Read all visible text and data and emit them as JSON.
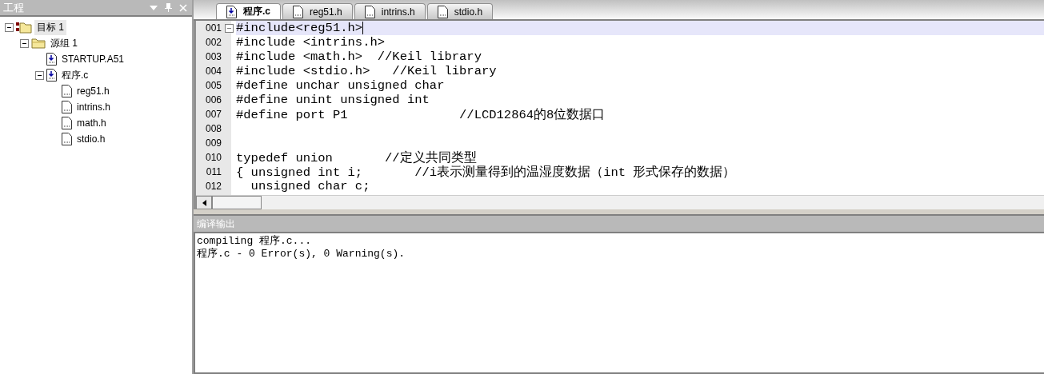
{
  "project_panel": {
    "title": "工程",
    "tree": [
      {
        "label": "目标 1",
        "kind": "target",
        "selected": true,
        "expanded": true,
        "children": [
          {
            "label": "源组 1",
            "kind": "folder",
            "selected": false,
            "expanded": true,
            "children": [
              {
                "label": "STARTUP.A51",
                "kind": "source",
                "selected": false
              },
              {
                "label": "程序.c",
                "kind": "source",
                "selected": false,
                "expanded": true,
                "children": [
                  {
                    "label": "reg51.h",
                    "kind": "header",
                    "selected": false
                  },
                  {
                    "label": "intrins.h",
                    "kind": "header",
                    "selected": false
                  },
                  {
                    "label": "math.h",
                    "kind": "header",
                    "selected": false
                  },
                  {
                    "label": "stdio.h",
                    "kind": "header",
                    "selected": false
                  }
                ]
              }
            ]
          }
        ]
      }
    ]
  },
  "tabs": [
    {
      "label": "程序.c",
      "kind": "source",
      "selected": true
    },
    {
      "label": "reg51.h",
      "kind": "header",
      "selected": false
    },
    {
      "label": "intrins.h",
      "kind": "header",
      "selected": false
    },
    {
      "label": "stdio.h",
      "kind": "header",
      "selected": false
    }
  ],
  "editor": {
    "lines": [
      {
        "number": "001",
        "text": "#include<reg51.h>",
        "highlighted": true,
        "foldable": true
      },
      {
        "number": "002",
        "text": "#include <intrins.h>",
        "highlighted": false,
        "foldable": false
      },
      {
        "number": "003",
        "text": "#include <math.h>  //Keil library",
        "highlighted": false,
        "foldable": false
      },
      {
        "number": "004",
        "text": "#include <stdio.h>   //Keil library",
        "highlighted": false,
        "foldable": false
      },
      {
        "number": "005",
        "text": "#define unchar unsigned char",
        "highlighted": false,
        "foldable": false
      },
      {
        "number": "006",
        "text": "#define unint unsigned int",
        "highlighted": false,
        "foldable": false
      },
      {
        "number": "007",
        "text": "#define port P1               //LCD12864的8位数据口",
        "highlighted": false,
        "foldable": false
      },
      {
        "number": "008",
        "highlighted": false,
        "foldable": false
      },
      {
        "number": "009",
        "highlighted": false,
        "foldable": false
      },
      {
        "number": "010",
        "text": "typedef union       //定义共同类型",
        "highlighted": false,
        "foldable": false
      },
      {
        "number": "011",
        "text": "{ unsigned int i;       //i表示测量得到的温湿度数据（int 形式保存的数据）",
        "highlighted": false,
        "foldable": false
      },
      {
        "number": "012",
        "text": "  unsigned char c;",
        "highlighted": false,
        "foldable": false
      }
    ]
  },
  "output": {
    "title": "编译输出",
    "lines": [
      "compiling 程序.c...",
      "程序.c - 0 Error(s), 0 Warning(s)."
    ]
  }
}
